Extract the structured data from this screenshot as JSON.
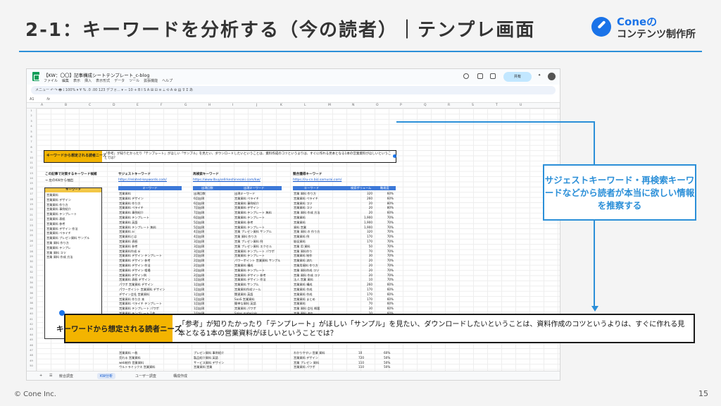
{
  "slide": {
    "title": "2-1：キーワードを分析する（今の読者）｜テンプレ画面",
    "logo_line1": "Coneの",
    "logo_line2": "コンテンツ制作所",
    "footer": "© Cone Inc.",
    "page_number": "15",
    "accent_color": "#2b8fd8",
    "highlight_color": "#f3b400"
  },
  "sheet": {
    "doc_title": "【KW：〇〇】記事構成シートテンプレート_c-blog",
    "menu": [
      "ファイル",
      "編集",
      "表示",
      "挿入",
      "表示形式",
      "データ",
      "ツール",
      "拡張機能",
      "ヘルプ"
    ],
    "share_label": "共有",
    "toolbar_text": "メニュー  ↶  ↷  🖶  ⟟  100%  ▾  ¥  %  .0  .00  123  デフォ...  ▾  −  10  +  B  I  S  A  ⊞  ⊟  ≡  ⟂  ⟲  A  ⊕  ▤  ⊽  Σ  あ",
    "cell_ref": "A1",
    "fx": "fx",
    "columns": [
      "A",
      "B",
      "C",
      "D",
      "E",
      "F",
      "G",
      "H",
      "I",
      "J",
      "K",
      "L",
      "M",
      "N",
      "O",
      "P",
      "Q",
      "R",
      "S",
      "T",
      "U"
    ],
    "small_needs_label": "キーワードから想定される読者ニーズ",
    "small_needs_text": "「参考」が知りたかったり「テンプレート」がほしい「サンプル」を見たい、ダウンロードしたいということは、資料作成のコツというよりは、すぐに作れる見本となる1本の営業資料がほしいということでは？",
    "target_kw_title": "この記事で対策するキーワード候補",
    "target_kw_note": "→ 左のKWから抽出",
    "kw_header": "キーワード",
    "target_keywords": [
      "営業資料",
      "営業資料 デザイン",
      "営業資料 作り方",
      "営業資料 事例紹介",
      "営業資料 テンプレート",
      "営業資料 表紙",
      "営業資料 参考",
      "営業資料 デザイン 作法",
      "営業資料 ペライチ",
      "営業資料 プレゼン資料 サンプル",
      "営業 資料 作り方",
      "営業資料 テンプレ",
      "営業 資料 コツ",
      "営業 資料 作成 方法"
    ],
    "suggest_title": "サジェストキーワード",
    "suggest_url": "https://related-keywords.com/",
    "suggest_header": "キーワード",
    "suggest_keywords": [
      "営業資料",
      "営業資料 デザイン",
      "営業資料 作り方",
      "営業資料 ペライチ",
      "営業資料 事例紹介",
      "営業資料 テンプレート",
      "営業資料 英語",
      "営業資料 テンプレート 無料",
      "営業資料 ai",
      "営業資料とは",
      "営業資料 表紙",
      "営業資料 参考",
      "営業資料作成 ai",
      "営業資料 デザイン テンプレート",
      "営業資料 デザイン 参考",
      "営業資料 デザイン 作法",
      "営業資料 デザイン 相場",
      "営業資料 デザイン例",
      "営業資料 表紙 デザイン",
      "パワポ 営業資料 デザイン",
      "パワーポイント 営業資料 デザイン",
      "デザイン会社 営業資料",
      "営業資料 作り方 本",
      "営業資料 ペライチ テンプレート",
      "営業資料 テンプレート パワポ",
      "営業資料 テンプレート 1枚",
      "営業資料 アイコン",
      "営業資料 1枚",
      "営業資料 ppt",
      "営業資料 アジェンダ"
    ],
    "research_title": "再検索キーワード",
    "research_url": "https://www.lbuysellrkeshinesaki.com/kw/",
    "research_headers": [
      "出現回数",
      "出現キーワード"
    ],
    "research_rows": [
      [
        "出現回数",
        "出現キーワード"
      ],
      [
        "6回出現",
        "営業資料 ペライチ"
      ],
      [
        "6回出現",
        "営業資料 事例紹介"
      ],
      [
        "7回出現",
        "営業資料 デザイン"
      ],
      [
        "7回出現",
        "営業資料 テンプレート 無料"
      ],
      [
        "6回出現",
        "営業資料 テンプレート"
      ],
      [
        "5回出現",
        "営業資料 参考"
      ],
      [
        "5回出現",
        "営業資料 テンプレート"
      ],
      [
        "4回出現",
        "営業 プレゼン資料 サンプル"
      ],
      [
        "4回出現",
        "営業 資料 作り方"
      ],
      [
        "3回出現",
        "営業 プレゼン資料 例"
      ],
      [
        "3回出現",
        "営業 プレゼン資料 エクセル"
      ],
      [
        "3回出現",
        "営業資料 テンプレート パワポ"
      ],
      [
        "2回出現",
        "営業資料 テンプレート"
      ],
      [
        "2回出現",
        "パワーポイント 営業資料 サンプル"
      ],
      [
        "2回出現",
        "営業資料 構成"
      ],
      [
        "2回出現",
        "営業資料 テンプレート"
      ],
      [
        "2回出現",
        "営業資料 デザイン 参考"
      ],
      [
        "1回出現",
        "営業資料 デザイン 作法"
      ],
      [
        "1回出現",
        "営業資料 サンプル"
      ],
      [
        "1回出現",
        "営業資料作成ツール"
      ],
      [
        "1回出現",
        "関連資料 英語"
      ],
      [
        "1回出現",
        "SaaS 営業資料"
      ],
      [
        "1回出現",
        "簡単な資料 英語"
      ],
      [
        "1回出現",
        "営業資料 パワポ"
      ],
      [
        "1回出現",
        "Sales materials"
      ],
      [
        "1回出現",
        "サービス紹介資料 英語"
      ],
      [
        "1回出現",
        "ペライチ 提案書"
      ],
      [
        "1回出現",
        "営業資料 英語 テンプレート"
      ]
    ],
    "competitor_title": "競合獲得キーワード",
    "competitor_url": "https://ru-cn.biz.samurai.com/",
    "competitor_headers": [
      "キーワード",
      "検索ボリューム",
      "難易度"
    ],
    "competitor_rows": [
      [
        "営業 資料 作り方",
        "320",
        "60%"
      ],
      [
        "営業資料 ペライチ",
        "260",
        "60%"
      ],
      [
        "営業資料 コツ",
        "20",
        "80%"
      ],
      [
        "営業資料 コツ",
        "20",
        "80%"
      ],
      [
        "営業 資料 作成 方法",
        "20",
        "60%"
      ],
      [
        "営業資料",
        "1,900",
        "70%"
      ],
      [
        "営業資料",
        "1,900",
        "70%"
      ],
      [
        "資料 営業",
        "1,900",
        "70%"
      ],
      [
        "営業 資料 の 作り方",
        "320",
        "70%"
      ],
      [
        "営業資料 例",
        "170",
        "70%"
      ],
      [
        "販促資料",
        "170",
        "70%"
      ],
      [
        "営業 用 資料",
        "50",
        "70%"
      ],
      [
        "営業 資料作り",
        "70",
        "70%"
      ],
      [
        "営業資料 制作",
        "30",
        "70%"
      ],
      [
        "営業資料 流れ",
        "20",
        "70%"
      ],
      [
        "営業用資料 作り方",
        "20",
        "70%"
      ],
      [
        "営業 資料作成 コツ",
        "20",
        "70%"
      ],
      [
        "営業 資料 作成 コツ",
        "20",
        "70%"
      ],
      [
        "法人 営業 資料",
        "10",
        "70%"
      ],
      [
        "営業資料 構成",
        "260",
        "60%"
      ],
      [
        "営業資料 作成",
        "170",
        "60%"
      ],
      [
        "営業資料 作成",
        "170",
        "60%"
      ],
      [
        "営業資料 まとめ",
        "170",
        "60%"
      ],
      [
        "営業資料",
        "70",
        "60%"
      ],
      [
        "営業 資料 会社 概要",
        "30",
        "60%"
      ],
      [
        "営業 資料 流れ",
        "20",
        "60%"
      ],
      [
        "営業資料 英語",
        "10",
        "60%"
      ],
      [
        "商品 営業資料",
        "10",
        "60%"
      ],
      [
        "営業資料 内容",
        "10",
        "60%"
      ],
      [
        "営業資料 わかりやすい",
        "10",
        "60%"
      ]
    ],
    "bottom_rows": [
      [
        "営業資料 一枚",
        "プレゼン資料 事例紹介",
        "わかりやすい 営業 資料",
        "10",
        "60%"
      ],
      [
        "売れる 営業資料",
        "製品紹介資料 英語",
        "営業資料 デザイン",
        "720",
        "50%"
      ],
      [
        "web制作 営業資料",
        "サービス資料 デザイン",
        "営業 プレゼン 資料",
        "110",
        "50%"
      ],
      [
        "ウルトラミックス 営業資料",
        "営業資料 営業",
        "営業資料 パワポ",
        "110",
        "50%"
      ]
    ],
    "tabs": [
      "+",
      "☰",
      "競合調査",
      "KW分析",
      "ユーザー調査",
      "構成作成"
    ],
    "active_tab": "KW分析"
  },
  "callout_text": "サジェストキーワード・再検索キーワードなどから読者が本当に欲しい情報を推察する",
  "big_needs": {
    "label": "キーワードから想定される読者ニーズ",
    "text": "「参考」が知りたかったり「テンプレート」がほしい「サンプル」を見たい、ダウンロードしたいということは、資料作成のコツというよりは、すぐに作れる見本となる1本の営業資料がほしいということでは？"
  }
}
